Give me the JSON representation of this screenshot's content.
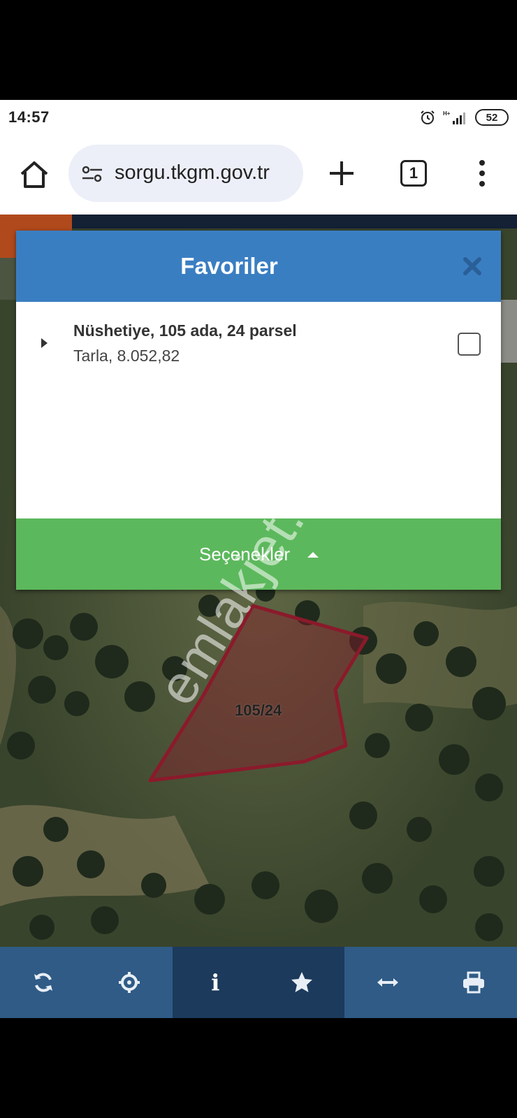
{
  "status_bar": {
    "time": "14:57",
    "network": "H+",
    "battery": "52"
  },
  "browser": {
    "url": "sorgu.tkgm.gov.tr",
    "tab_count": "1"
  },
  "favorites_dialog": {
    "title": "Favoriler",
    "items": [
      {
        "title": "Nüshetiye, 105 ada, 24 parsel",
        "subtitle": "Tarla, 8.052,82",
        "checked": false
      }
    ],
    "options_label": "Seçenekler",
    "header_color": "#3a7ec2",
    "options_color": "#5cb85c"
  },
  "map": {
    "parcel_label": "105/24",
    "parcel_color": "#8b1a2b"
  },
  "watermark": "emlakjet.com",
  "toolbar": {
    "buttons": [
      "refresh-icon",
      "locate-icon",
      "info-icon",
      "star-icon",
      "measure-icon",
      "print-icon"
    ],
    "active": [
      "info-icon",
      "star-icon"
    ],
    "color": "#2f5b86"
  }
}
